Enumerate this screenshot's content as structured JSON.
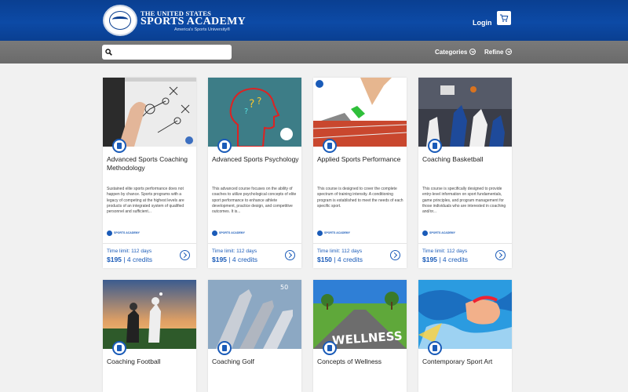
{
  "header": {
    "logo_line1": "THE UNITED STATES",
    "logo_line2": "SPORTS ACADEMY",
    "logo_tagline": "America's Sports University®",
    "login_label": "Login"
  },
  "search": {
    "placeholder": "",
    "value": ""
  },
  "filters": {
    "categories_label": "Categories",
    "refine_label": "Refine"
  },
  "colors": {
    "header_blue": "#0c4aa6",
    "accent_blue": "#1a5bb8",
    "toolbar_gray": "#707070"
  },
  "cards": [
    {
      "title": "Advanced Sports Coaching Methodology",
      "description": "Sustained elite sports performance does not happen by chance. Sports programs with a legacy of competing at the highest levels are products of an integrated system of qualified personnel and sufficient...",
      "time_limit": "Time limit: 112 days",
      "price": "$195",
      "credits": "4 credits"
    },
    {
      "title": "Advanced Sports Psychology",
      "description": "This advanced course focuses on the ability of coaches to utilize psychological concepts of elite sport performance to enhance athlete development, practice design, and competitive outcomes. It is...",
      "time_limit": "Time limit: 112 days",
      "price": "$195",
      "credits": "4 credits"
    },
    {
      "title": "Applied Sports Performance",
      "description": "This course is designed to cover the complete spectrum of training intensity. A conditioning program is established to meet the needs of each specific sport.",
      "time_limit": "Time limit: 112 days",
      "price": "$150",
      "credits": "4 credits"
    },
    {
      "title": "Coaching Basketball",
      "description": "This course is specifically designed to provide entry-level information on sport fundamentals, game principles, and program management for those individuals who are interested in coaching and/or...",
      "time_limit": "Time limit: 112 days",
      "price": "$195",
      "credits": "4 credits"
    },
    {
      "title": "Coaching Football"
    },
    {
      "title": "Coaching Golf"
    },
    {
      "title": "Concepts of Wellness"
    },
    {
      "title": "Contemporary Sport Art"
    }
  ],
  "brand_small": "SPORTS ACADEMY"
}
